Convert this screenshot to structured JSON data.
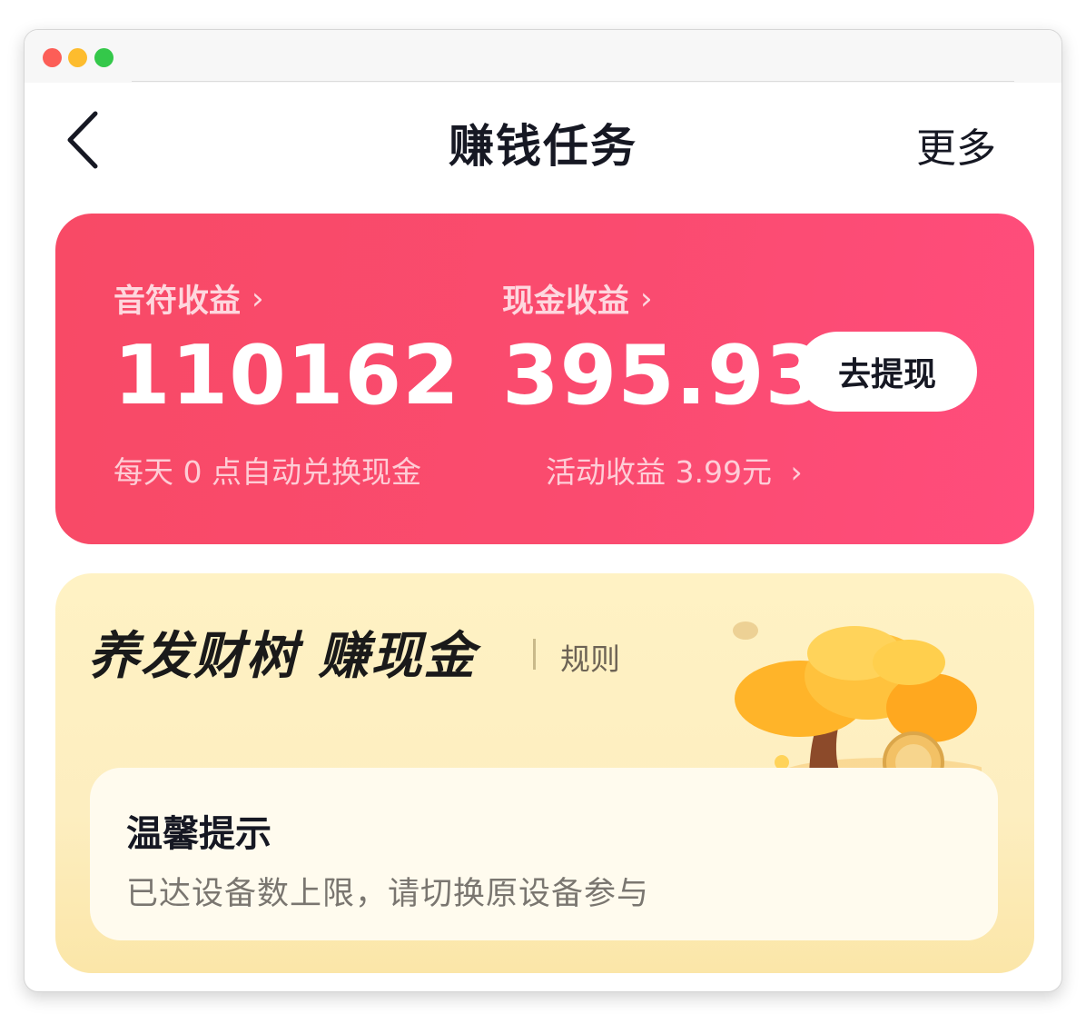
{
  "nav": {
    "title": "赚钱任务",
    "more": "更多"
  },
  "earnings": {
    "notes_label": "音符收益",
    "notes_value": "110162",
    "notes_sub": "每天 0 点自动兑换现金",
    "cash_label": "现金收益",
    "cash_value": "395.93",
    "activity_sub": "活动收益 3.99元",
    "withdraw_label": "去提现",
    "chevron": "›"
  },
  "money_tree": {
    "title": "养发财树 赚现金",
    "rules": "规则",
    "tip_title": "温馨提示",
    "tip_text": "已达设备数上限，请切换原设备参与"
  },
  "colors": {
    "card_red": "#f84a66",
    "card_pink": "#ff4d7c",
    "tree_bg": "#fff2c4",
    "text_dark": "#161823"
  }
}
